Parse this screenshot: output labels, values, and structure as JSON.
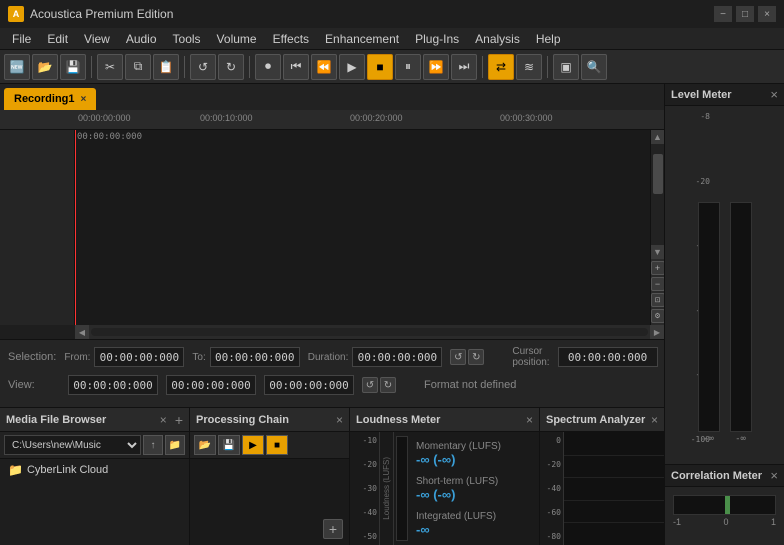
{
  "app": {
    "title": "Acoustica Premium Edition",
    "icon": "A"
  },
  "titlebar": {
    "minimize": "−",
    "maximize": "□",
    "close": "×"
  },
  "menu": {
    "items": [
      "File",
      "Edit",
      "View",
      "Audio",
      "Tools",
      "Volume",
      "Effects",
      "Enhancement",
      "Plug-Ins",
      "Analysis",
      "Help"
    ]
  },
  "tabs": {
    "recording1": "Recording1",
    "close": "×"
  },
  "transport": {
    "time_display": "00:00:00:000"
  },
  "info": {
    "selection_label": "Selection:",
    "view_label": "View:",
    "from_label": "From:",
    "to_label": "To:",
    "duration_label": "Duration:",
    "cursor_label": "Cursor position:",
    "format_label": "Format not defined",
    "sel_from": "00:00:00:000",
    "sel_to": "00:00:00:000",
    "sel_duration": "00:00:00:000",
    "view_from": "00:00:00:000",
    "view_to": "00:00:00:000",
    "view_duration": "00:00:00:000",
    "cursor_pos": "00:00:00:000"
  },
  "right_panel": {
    "level_meter": {
      "title": "Level Meter",
      "close": "×",
      "scale": [
        "-8",
        "-20",
        "-40",
        "-60",
        "-80",
        "-100"
      ],
      "ch_labels": [
        "-∞",
        "-∞"
      ]
    },
    "correlation_meter": {
      "title": "Correlation Meter",
      "close": "×",
      "labels": [
        "-1",
        "0",
        "1"
      ]
    }
  },
  "bottom_panels": {
    "media_browser": {
      "title": "Media File Browser",
      "close": "×",
      "add": "+",
      "path": "C:\\Users\\new\\Music",
      "items": [
        {
          "icon": "folder",
          "name": "CyberLink Cloud"
        }
      ]
    },
    "processing_chain": {
      "title": "Processing Chain",
      "close": "×",
      "add": "+"
    },
    "loudness_meter": {
      "title": "Loudness Meter",
      "close": "×",
      "scale": [
        "-10",
        "-20",
        "-30",
        "-40",
        "-50"
      ],
      "lufs_label": "Loudness (LUFS)",
      "momentary_label": "Momentary (LUFS)",
      "momentary_value": "-∞ (-∞)",
      "shortterm_label": "Short-term (LUFS)",
      "shortterm_value": "-∞ (-∞)",
      "integrated_label": "Integrated (LUFS)",
      "integrated_value": "-∞"
    },
    "spectrum_analyzer": {
      "title": "Spectrum Analyzer",
      "close": "×",
      "scale": [
        "0",
        "-20",
        "-40",
        "-60",
        "-80"
      ]
    }
  }
}
